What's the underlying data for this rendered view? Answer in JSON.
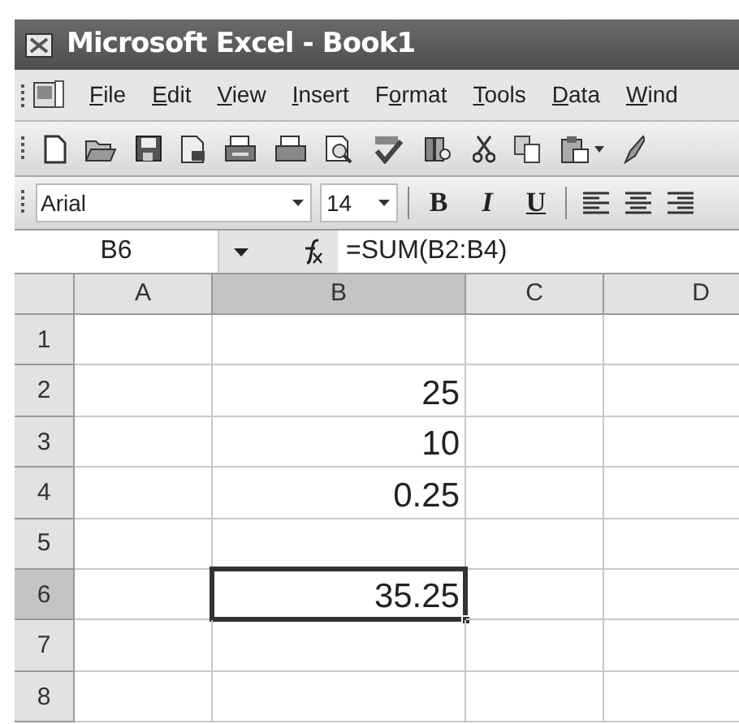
{
  "window": {
    "title": "Microsoft Excel - Book1"
  },
  "menu": [
    {
      "parts": [
        {
          "text": "F",
          "underlined": true
        },
        {
          "text": "ile",
          "underlined": false
        }
      ]
    },
    {
      "parts": [
        {
          "text": "E",
          "underlined": true
        },
        {
          "text": "dit",
          "underlined": false
        }
      ]
    },
    {
      "parts": [
        {
          "text": "V",
          "underlined": true
        },
        {
          "text": "iew",
          "underlined": false
        }
      ]
    },
    {
      "parts": [
        {
          "text": "I",
          "underlined": true
        },
        {
          "text": "nsert",
          "underlined": false
        }
      ]
    },
    {
      "parts": [
        {
          "text": "F",
          "underlined": false
        },
        {
          "text": "o",
          "underlined": true
        },
        {
          "text": "rmat",
          "underlined": false
        }
      ]
    },
    {
      "parts": [
        {
          "text": "T",
          "underlined": true
        },
        {
          "text": "ools",
          "underlined": false
        }
      ]
    },
    {
      "parts": [
        {
          "text": "D",
          "underlined": true
        },
        {
          "text": "ata",
          "underlined": false
        }
      ]
    },
    {
      "parts": [
        {
          "text": "W",
          "underlined": true
        },
        {
          "text": "ind",
          "underlined": false
        }
      ]
    }
  ],
  "format_toolbar": {
    "font": "Arial",
    "size": "14",
    "bold": "B",
    "italic": "I",
    "underline": "U"
  },
  "formula_bar": {
    "name_box": "B6",
    "formula": "=SUM(B2:B4)"
  },
  "columns": [
    {
      "label": "A",
      "selected": false
    },
    {
      "label": "B",
      "selected": true
    },
    {
      "label": "C",
      "selected": false
    },
    {
      "label": "D",
      "selected": false
    }
  ],
  "rows": [
    {
      "label": "1",
      "selected": false,
      "column_b_active": false
    },
    {
      "label": "2",
      "selected": false,
      "column_b": "25",
      "column_b_active": false
    },
    {
      "label": "3",
      "selected": false,
      "column_b": "10",
      "column_b_active": false
    },
    {
      "label": "4",
      "selected": false,
      "column_b": "0.25",
      "column_b_active": false
    },
    {
      "label": "5",
      "selected": false,
      "column_b_active": false
    },
    {
      "label": "6",
      "selected": true,
      "column_b": "35.25",
      "column_b_active": true
    },
    {
      "label": "7",
      "selected": false,
      "column_b_active": false
    },
    {
      "label": "8",
      "selected": false,
      "column_b_active": false
    }
  ]
}
